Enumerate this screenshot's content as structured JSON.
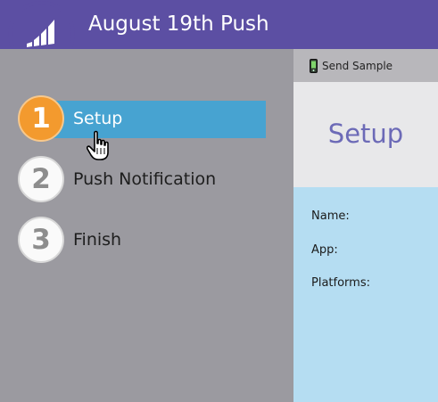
{
  "header": {
    "title": "August 19th Push"
  },
  "logo": {
    "icon": "marketo-bars-icon",
    "color": "#5c4fa3"
  },
  "steps": [
    {
      "number": "1",
      "label": "Setup",
      "active": true
    },
    {
      "number": "2",
      "label": "Push Notification",
      "active": false
    },
    {
      "number": "3",
      "label": "Finish",
      "active": false
    }
  ],
  "toolbar": {
    "send_sample_label": "Send Sample",
    "icon": "phone-send-icon"
  },
  "preview": {
    "title": "Setup",
    "fields": [
      {
        "label": "Name:"
      },
      {
        "label": "App:"
      },
      {
        "label": "Platforms:"
      }
    ]
  },
  "colors": {
    "header": "#5c4fa3",
    "sidebar": "#9b9aa0",
    "active_step": "#47a3d1",
    "active_circle": "#f39a2e",
    "preview_title": "#6c6ab7",
    "preview_body": "#b5ddf2"
  }
}
